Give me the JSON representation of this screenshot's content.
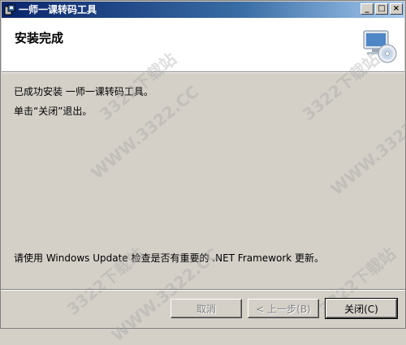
{
  "window": {
    "title": "一师一课转码工具",
    "controls": {
      "minimize": "_",
      "maximize": "□",
      "close": "×"
    }
  },
  "header": {
    "title": "安装完成",
    "graphic_icon": "computer-cd-icon"
  },
  "body": {
    "line1": "已成功安装 一师一课转码工具。",
    "line2": "单击“关闭”退出。",
    "line3": "请使用 Windows Update 检查是否有重要的 .NET Framework 更新。"
  },
  "buttons": {
    "cancel": "取消",
    "back": "< 上一步(B)",
    "close": "关闭(C)"
  },
  "watermark": {
    "text_a": "3322下载站",
    "text_b": "WWW.3322.CC"
  },
  "colors": {
    "titlebar_start": "#0a246a",
    "titlebar_end": "#a6caf0",
    "face": "#d4d0c8"
  }
}
